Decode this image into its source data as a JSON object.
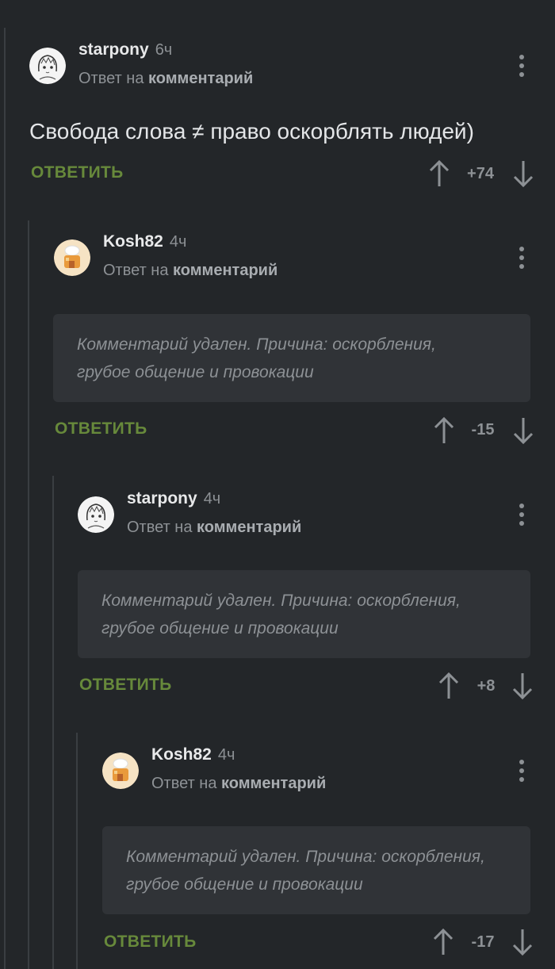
{
  "comments": [
    {
      "author": "starpony",
      "time": "6ч",
      "reply_prefix": "Ответ на",
      "reply_target": "комментарий",
      "text": "Свобода слова ≠ право оскорблять людей)",
      "reply_label": "ОТВЕТИТЬ",
      "score": "+74",
      "avatar": "sketch-girl-avatar"
    },
    {
      "author": "Kosh82",
      "time": "4ч",
      "reply_prefix": "Ответ на",
      "reply_target": "комментарий",
      "deleted_line1": "Комментарий удален. Причина: оскорбления,",
      "deleted_line2": "грубое общение и провокации",
      "reply_label": "ОТВЕТИТЬ",
      "score": "-15",
      "avatar": "chef-house-avatar"
    },
    {
      "author": "starpony",
      "time": "4ч",
      "reply_prefix": "Ответ на",
      "reply_target": "комментарий",
      "deleted_line1": "Комментарий удален. Причина: оскорбления,",
      "deleted_line2": "грубое общение и провокации",
      "reply_label": "ОТВЕТИТЬ",
      "score": "+8",
      "avatar": "sketch-girl-avatar"
    },
    {
      "author": "Kosh82",
      "time": "4ч",
      "reply_prefix": "Ответ на",
      "reply_target": "комментарий",
      "deleted_line1": "Комментарий удален. Причина: оскорбления,",
      "deleted_line2": "грубое общение и провокации",
      "reply_label": "ОТВЕТИТЬ",
      "score": "-17",
      "avatar": "chef-house-avatar"
    }
  ],
  "colors": {
    "background": "#232629",
    "reply_green": "#67893b",
    "muted": "#8d9195"
  }
}
